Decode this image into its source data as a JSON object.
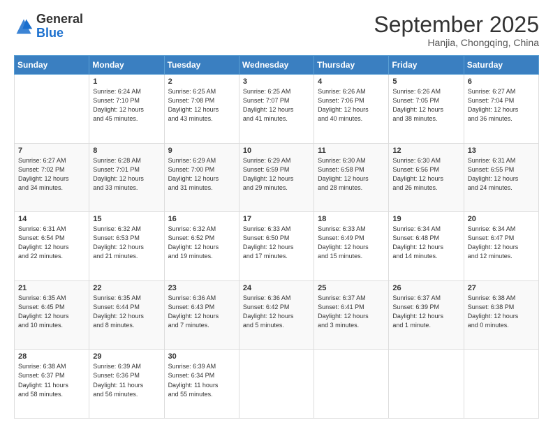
{
  "header": {
    "logo_general": "General",
    "logo_blue": "Blue",
    "title": "September 2025",
    "subtitle": "Hanjia, Chongqing, China"
  },
  "weekdays": [
    "Sunday",
    "Monday",
    "Tuesday",
    "Wednesday",
    "Thursday",
    "Friday",
    "Saturday"
  ],
  "rows": [
    [
      {
        "day": "",
        "lines": []
      },
      {
        "day": "1",
        "lines": [
          "Sunrise: 6:24 AM",
          "Sunset: 7:10 PM",
          "Daylight: 12 hours",
          "and 45 minutes."
        ]
      },
      {
        "day": "2",
        "lines": [
          "Sunrise: 6:25 AM",
          "Sunset: 7:08 PM",
          "Daylight: 12 hours",
          "and 43 minutes."
        ]
      },
      {
        "day": "3",
        "lines": [
          "Sunrise: 6:25 AM",
          "Sunset: 7:07 PM",
          "Daylight: 12 hours",
          "and 41 minutes."
        ]
      },
      {
        "day": "4",
        "lines": [
          "Sunrise: 6:26 AM",
          "Sunset: 7:06 PM",
          "Daylight: 12 hours",
          "and 40 minutes."
        ]
      },
      {
        "day": "5",
        "lines": [
          "Sunrise: 6:26 AM",
          "Sunset: 7:05 PM",
          "Daylight: 12 hours",
          "and 38 minutes."
        ]
      },
      {
        "day": "6",
        "lines": [
          "Sunrise: 6:27 AM",
          "Sunset: 7:04 PM",
          "Daylight: 12 hours",
          "and 36 minutes."
        ]
      }
    ],
    [
      {
        "day": "7",
        "lines": [
          "Sunrise: 6:27 AM",
          "Sunset: 7:02 PM",
          "Daylight: 12 hours",
          "and 34 minutes."
        ]
      },
      {
        "day": "8",
        "lines": [
          "Sunrise: 6:28 AM",
          "Sunset: 7:01 PM",
          "Daylight: 12 hours",
          "and 33 minutes."
        ]
      },
      {
        "day": "9",
        "lines": [
          "Sunrise: 6:29 AM",
          "Sunset: 7:00 PM",
          "Daylight: 12 hours",
          "and 31 minutes."
        ]
      },
      {
        "day": "10",
        "lines": [
          "Sunrise: 6:29 AM",
          "Sunset: 6:59 PM",
          "Daylight: 12 hours",
          "and 29 minutes."
        ]
      },
      {
        "day": "11",
        "lines": [
          "Sunrise: 6:30 AM",
          "Sunset: 6:58 PM",
          "Daylight: 12 hours",
          "and 28 minutes."
        ]
      },
      {
        "day": "12",
        "lines": [
          "Sunrise: 6:30 AM",
          "Sunset: 6:56 PM",
          "Daylight: 12 hours",
          "and 26 minutes."
        ]
      },
      {
        "day": "13",
        "lines": [
          "Sunrise: 6:31 AM",
          "Sunset: 6:55 PM",
          "Daylight: 12 hours",
          "and 24 minutes."
        ]
      }
    ],
    [
      {
        "day": "14",
        "lines": [
          "Sunrise: 6:31 AM",
          "Sunset: 6:54 PM",
          "Daylight: 12 hours",
          "and 22 minutes."
        ]
      },
      {
        "day": "15",
        "lines": [
          "Sunrise: 6:32 AM",
          "Sunset: 6:53 PM",
          "Daylight: 12 hours",
          "and 21 minutes."
        ]
      },
      {
        "day": "16",
        "lines": [
          "Sunrise: 6:32 AM",
          "Sunset: 6:52 PM",
          "Daylight: 12 hours",
          "and 19 minutes."
        ]
      },
      {
        "day": "17",
        "lines": [
          "Sunrise: 6:33 AM",
          "Sunset: 6:50 PM",
          "Daylight: 12 hours",
          "and 17 minutes."
        ]
      },
      {
        "day": "18",
        "lines": [
          "Sunrise: 6:33 AM",
          "Sunset: 6:49 PM",
          "Daylight: 12 hours",
          "and 15 minutes."
        ]
      },
      {
        "day": "19",
        "lines": [
          "Sunrise: 6:34 AM",
          "Sunset: 6:48 PM",
          "Daylight: 12 hours",
          "and 14 minutes."
        ]
      },
      {
        "day": "20",
        "lines": [
          "Sunrise: 6:34 AM",
          "Sunset: 6:47 PM",
          "Daylight: 12 hours",
          "and 12 minutes."
        ]
      }
    ],
    [
      {
        "day": "21",
        "lines": [
          "Sunrise: 6:35 AM",
          "Sunset: 6:45 PM",
          "Daylight: 12 hours",
          "and 10 minutes."
        ]
      },
      {
        "day": "22",
        "lines": [
          "Sunrise: 6:35 AM",
          "Sunset: 6:44 PM",
          "Daylight: 12 hours",
          "and 8 minutes."
        ]
      },
      {
        "day": "23",
        "lines": [
          "Sunrise: 6:36 AM",
          "Sunset: 6:43 PM",
          "Daylight: 12 hours",
          "and 7 minutes."
        ]
      },
      {
        "day": "24",
        "lines": [
          "Sunrise: 6:36 AM",
          "Sunset: 6:42 PM",
          "Daylight: 12 hours",
          "and 5 minutes."
        ]
      },
      {
        "day": "25",
        "lines": [
          "Sunrise: 6:37 AM",
          "Sunset: 6:41 PM",
          "Daylight: 12 hours",
          "and 3 minutes."
        ]
      },
      {
        "day": "26",
        "lines": [
          "Sunrise: 6:37 AM",
          "Sunset: 6:39 PM",
          "Daylight: 12 hours",
          "and 1 minute."
        ]
      },
      {
        "day": "27",
        "lines": [
          "Sunrise: 6:38 AM",
          "Sunset: 6:38 PM",
          "Daylight: 12 hours",
          "and 0 minutes."
        ]
      }
    ],
    [
      {
        "day": "28",
        "lines": [
          "Sunrise: 6:38 AM",
          "Sunset: 6:37 PM",
          "Daylight: 11 hours",
          "and 58 minutes."
        ]
      },
      {
        "day": "29",
        "lines": [
          "Sunrise: 6:39 AM",
          "Sunset: 6:36 PM",
          "Daylight: 11 hours",
          "and 56 minutes."
        ]
      },
      {
        "day": "30",
        "lines": [
          "Sunrise: 6:39 AM",
          "Sunset: 6:34 PM",
          "Daylight: 11 hours",
          "and 55 minutes."
        ]
      },
      {
        "day": "",
        "lines": []
      },
      {
        "day": "",
        "lines": []
      },
      {
        "day": "",
        "lines": []
      },
      {
        "day": "",
        "lines": []
      }
    ]
  ]
}
